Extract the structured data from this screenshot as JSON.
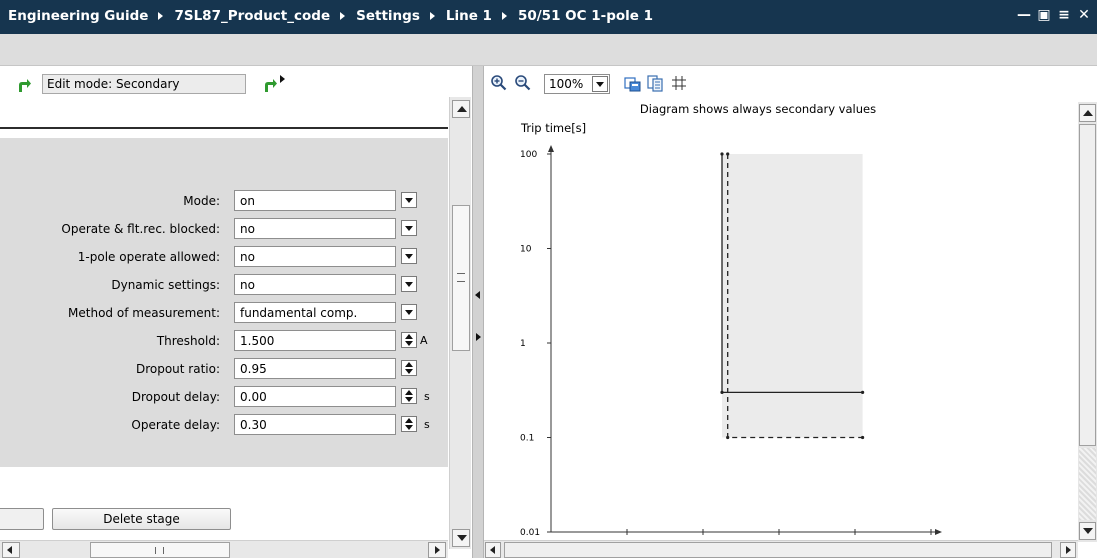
{
  "window": {
    "breadcrumb": [
      "Engineering Guide",
      "7SL87_Product_code",
      "Settings",
      "Line 1",
      "50/51 OC 1-pole 1"
    ],
    "controls": [
      "minimize-icon",
      "restore-icon",
      "menu-icon",
      "close-icon"
    ],
    "title_bar_color": "#16354f"
  },
  "left_toolbar": {
    "edit_mode": "Edit mode: Secondary",
    "icons": [
      "green-arrow-icon",
      "green-arrow-icon",
      "dropdown-arrow-icon"
    ],
    "accent_color": "#2f9a2f"
  },
  "settings": [
    {
      "label": "Mode:",
      "value": "on",
      "control": "dropdown",
      "unit": ""
    },
    {
      "label": "Operate & flt.rec. blocked:",
      "value": "no",
      "control": "dropdown",
      "unit": ""
    },
    {
      "label": "1-pole operate allowed:",
      "value": "no",
      "control": "dropdown",
      "unit": ""
    },
    {
      "label": "Dynamic settings:",
      "value": "no",
      "control": "dropdown",
      "unit": ""
    },
    {
      "label": "Method of measurement:",
      "value": "fundamental comp.",
      "control": "dropdown",
      "unit": ""
    },
    {
      "label": "Threshold:",
      "value": "1.500",
      "control": "spinner",
      "unit": "A"
    },
    {
      "label": "Dropout ratio:",
      "value": "0.95",
      "control": "spinner",
      "unit": ""
    },
    {
      "label": "Dropout delay:",
      "value": "0.00",
      "control": "spinner",
      "unit": "s"
    },
    {
      "label": "Operate delay:",
      "value": "0.30",
      "control": "spinner",
      "unit": "s"
    }
  ],
  "buttons": {
    "delete_stage": "Delete stage"
  },
  "diagram_toolbar": {
    "zoom": "100%",
    "icons": [
      "zoom-in-icon",
      "zoom-out-icon",
      "export-icon",
      "copy-icon",
      "grid-icon"
    ]
  },
  "chart_data": {
    "type": "line",
    "title": "Diagram shows always secondary values",
    "ylabel": "Trip time[s]",
    "xlabel": "",
    "yscale": "log",
    "ylim": [
      0.01,
      100
    ],
    "yticks": [
      "100",
      "10",
      "1",
      "0.1",
      "0.01"
    ],
    "xlim": [
      0,
      10
    ],
    "xticks": [
      2,
      4,
      6,
      8,
      10
    ],
    "grid": false,
    "shaded_region": {
      "x": [
        4.5,
        8.2
      ],
      "y": [
        0.1,
        100
      ],
      "color": "#ebebeb"
    },
    "series": [
      {
        "style": "solid",
        "x": [
          4.5,
          4.5,
          8.2
        ],
        "y": [
          100,
          0.3,
          0.3
        ]
      },
      {
        "style": "dashed",
        "x": [
          4.65,
          4.65,
          8.2
        ],
        "y": [
          100,
          0.1,
          0.1
        ]
      }
    ]
  }
}
